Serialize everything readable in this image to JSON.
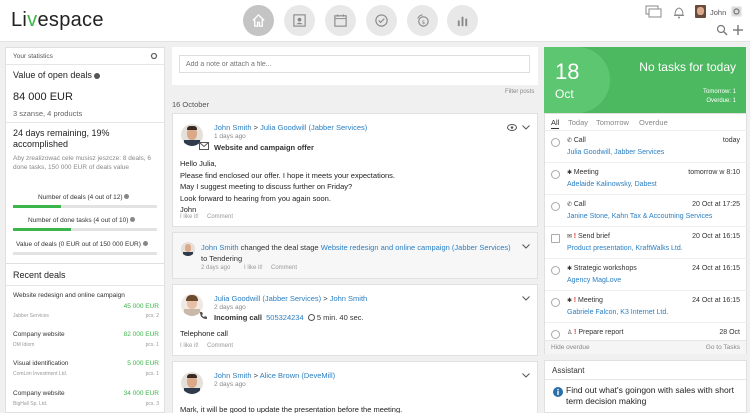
{
  "brand": {
    "logo_pre": "Li",
    "logo_dot": "v",
    "logo_post": "espace"
  },
  "user": {
    "name": "John"
  },
  "stats": {
    "header": "Your statistics",
    "open_deals_label": "Value of open deals",
    "open_deals_value": "84 000 EUR",
    "open_deals_sub": "3 szanse, 4 products",
    "remaining": "24 days remaining, 19% accomplished",
    "hint": "Aby zrealizować cele musisz jeszcze: 8 deals, 6 done tasks, 150 000 EUR of deals value",
    "goals": [
      {
        "label": "Number of deals (4 out of 12)",
        "progress": 0.33
      },
      {
        "label": "Number of done tasks (4 out of 10)",
        "progress": 0.4
      },
      {
        "label": "Value of deals (0 EUR out of 150 000 EUR)",
        "progress": 0
      }
    ]
  },
  "recent": {
    "title": "Recent deals",
    "items": [
      {
        "name": "Website redesign and online campaign",
        "value": "45 000 EUR",
        "company": "Jabber Services",
        "pcs": "pcs. 2"
      },
      {
        "name": "Company website",
        "value": "82 000 EUR",
        "company": "DM Idiom",
        "pcs": "pcs. 1"
      },
      {
        "name": "Visual identification",
        "value": "5 000 EUR",
        "company": "ComLim Investment Ltd.",
        "pcs": "pcs. 1"
      },
      {
        "name": "Company website",
        "value": "34 000 EUR",
        "company": "BigHall Sp. Ltd.",
        "pcs": "pcs. 3"
      }
    ]
  },
  "feed": {
    "note_placeholder": "Add a note or attach a file...",
    "filter": "Filter posts",
    "date": "16 October",
    "post1": {
      "author": "John Smith",
      "arrow": ">",
      "target": "Julia Goodwill (Jabber Services)",
      "time": "1 days ago",
      "subject": "Website and campaign offer",
      "body": [
        "Hello Julia,",
        "Please find enclosed our offer. I hope it meets your expectations.",
        "May I suggest meeting to discuss further on Friday?",
        "Look forward to hearing from you again soon.",
        "John"
      ],
      "like": "I like it!",
      "comment": "Comment"
    },
    "post2": {
      "author": "John Smith",
      "text": "changed the deal stage",
      "deal": "Website redesign and online campaign (Jabber Services)",
      "stage": "to Tendering",
      "time": "2 days ago",
      "like": "I like it!",
      "comment": "Comment"
    },
    "post3": {
      "author": "Julia Goodwill (Jabber Services)",
      "arrow": ">",
      "target": "John Smith",
      "time": "2 days ago",
      "call": "Incoming call",
      "phone": "505324234",
      "duration": "5 min. 40 sec.",
      "body": "Telephone call",
      "like": "I like it!",
      "comment": "Comment"
    },
    "post4": {
      "author": "John Smith",
      "arrow": ">",
      "target": "Alice Brown (DeveMill)",
      "time": "2 days ago",
      "body": "Mark, it will be good to update the presentation before the meeting."
    }
  },
  "tasks": {
    "day": "18",
    "month": "Oct",
    "headline": "No tasks for today",
    "tomorrow": "Tomorrow: 1",
    "overdue": "Overdue: 1",
    "tabs": [
      "All",
      "Today",
      "Tomorrow",
      "Overdue"
    ],
    "items": [
      {
        "type": "Call",
        "when": "today",
        "link": "Julia Goodwill, Jabber Services"
      },
      {
        "type": "Meeting",
        "when": "tomorrow w 8:10",
        "link": "Adelaide Kalinowsky, Dabest"
      },
      {
        "type": "Call",
        "when": "20 Oct at 17:25",
        "link": "Janine Stone, Kahn Tax & Accoutning Services"
      },
      {
        "type": "Send brief",
        "when": "20 Oct at 16:15",
        "link": "Product presentation, KraftWalks Ltd."
      },
      {
        "type": "Strategic workshops",
        "when": "24 Oct at 16:15",
        "link": "Agency MagLove"
      },
      {
        "type": "Meeting",
        "when": "24 Oct at 16:15",
        "link": "Gabriele Falcon, K3 Internet Ltd."
      },
      {
        "type": "Prepare report",
        "when": "28 Oct",
        "link": ""
      }
    ],
    "hide": "Hide overdue",
    "goto": "Go to Tasks"
  },
  "assistant": {
    "title": "Assistant",
    "text": "Find out what's goingon with sales with short term decision making"
  },
  "colors": {
    "accent": "#3cb54a",
    "link": "#2b7fc2"
  }
}
